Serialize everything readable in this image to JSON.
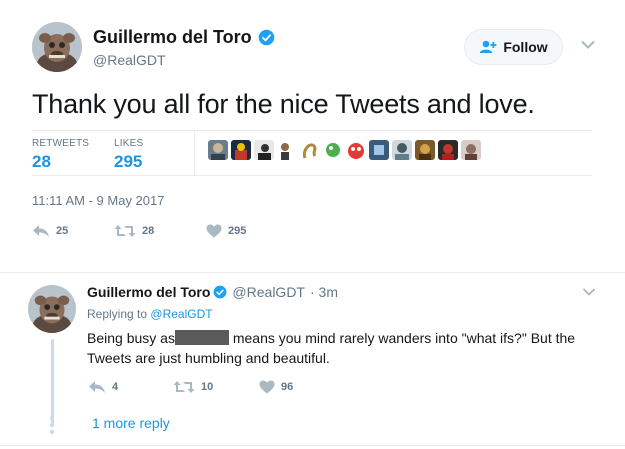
{
  "tweet": {
    "author_name": "Guillermo del Toro",
    "author_handle": "@RealGDT",
    "follow_label": "Follow",
    "text": "Thank you all for the nice Tweets and love.",
    "retweets_label": "RETWEETS",
    "retweets_count": "28",
    "likes_label": "LIKES",
    "likes_count": "295",
    "timestamp": "11:11 AM - 9 May 2017",
    "actions": {
      "reply_count": "25",
      "retweet_count": "28",
      "like_count": "295"
    }
  },
  "reply": {
    "author_name": "Guillermo del Toro",
    "author_handle": "@RealGDT",
    "time": "· 3m",
    "replying_to_prefix": "Replying to",
    "replying_to_handle": "@RealGDT",
    "text_before": "Being busy as",
    "text_after": "means you mind rarely wanders into \"what ifs?\" But the Tweets are just humbling and beautiful.",
    "actions": {
      "reply_count": "4",
      "retweet_count": "10",
      "like_count": "96"
    },
    "more_replies": "1 more reply"
  },
  "colors": {
    "accent": "#1b95e0",
    "muted": "#657786",
    "border": "#e6ecf0"
  },
  "icons": [
    "verified-badge-icon",
    "add-person-icon",
    "chevron-down-icon",
    "reply-icon",
    "retweet-icon",
    "heart-icon"
  ]
}
